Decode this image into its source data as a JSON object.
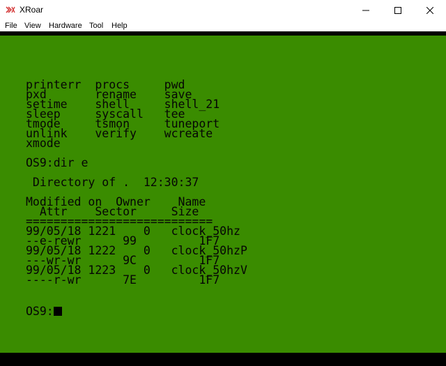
{
  "window": {
    "title": "XRoar"
  },
  "menu": {
    "file": "File",
    "view": "View",
    "hardware": "Hardware",
    "tool": "Tool",
    "help": "Help"
  },
  "terminal": {
    "lines": [
      "printerr  procs     pwd",
      "pxd       rename    save",
      "setime    shell     shell_21",
      "sleep     syscall   tee",
      "tmode     tsmon     tuneport",
      "unlink    verify    wcreate",
      "xmode",
      "",
      "OS9:dir e",
      "",
      " Directory of .  12:30:37",
      "",
      "Modified on  Owner    Name",
      "  Attr    Sector     Size",
      "===========================",
      "99/05/18 1221    0   clock_50hz",
      "--e-rewr      99         1F7",
      "99/05/18 1222    0   clock_50hzP",
      "---wr-wr      9C         1F7",
      "99/05/18 1223    0   clock_50hzV",
      "----r-wr      7E         1F7",
      "",
      "OS9:"
    ]
  },
  "icons": {
    "app": "xroar-logo-icon",
    "minimize": "minimize-icon",
    "maximize": "maximize-icon",
    "close": "close-icon"
  },
  "colors": {
    "screen_background": "#3a8c00",
    "text": "#050505",
    "border": "#000000"
  }
}
